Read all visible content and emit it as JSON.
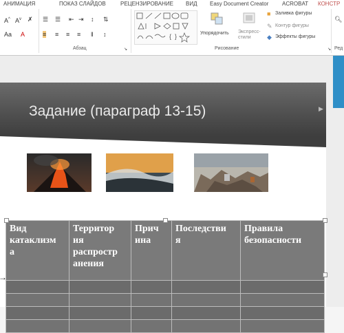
{
  "tabs": [
    "АНИМАЦИЯ",
    "ПОКАЗ СЛАЙДОВ",
    "РЕЦЕНЗИРОВАНИЕ",
    "ВИД",
    "Easy Document Creator",
    "ACROBAT",
    "КОНСТР"
  ],
  "ribbon": {
    "group_paragraph": "Абзац",
    "group_drawing": "Рисование",
    "group_edit_partial": "Ред",
    "arrange_label": "Упорядочить",
    "quick_styles_label": "Экспресс-\nстили",
    "shape_fill": "Заливка фигуры",
    "shape_outline": "Контур фигуры",
    "shape_effects": "Эффекты фигуры"
  },
  "slide": {
    "title": "Задание (параграф 13-15)",
    "table": {
      "headers": [
        "Вид катаклизма",
        "Территория распространения",
        "Причина",
        "Последствия",
        "Правила безопасности"
      ],
      "header_lines": [
        [
          "Вид",
          "катаклизм",
          "а"
        ],
        [
          "Территор",
          "ия",
          "распростр",
          "анения"
        ],
        [
          "Прич",
          "ина"
        ],
        [
          "Последстви",
          "я"
        ],
        [
          "Правила",
          "безопасности"
        ]
      ],
      "empty_rows": 4
    }
  },
  "colors": {
    "title_band": "#4f4f4f",
    "table_fill": "#7a7a7a",
    "accent_blue": "#2f8fc7"
  }
}
